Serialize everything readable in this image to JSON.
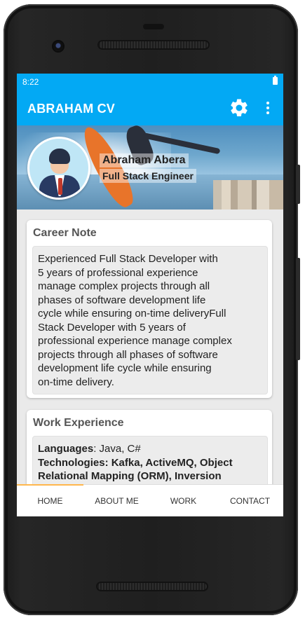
{
  "status_bar": {
    "time": "8:22"
  },
  "app_bar": {
    "title": "ABRAHAM CV",
    "settings_icon": "gear-icon",
    "menu_icon": "more-vert-icon"
  },
  "profile": {
    "name": "Abraham Abera",
    "role": "Full Stack Engineer"
  },
  "career_note": {
    "title": "Career Note",
    "lines": [
      "Experienced Full Stack Developer with",
      "5 years of professional experience",
      "manage complex projects through all",
      "phases of software development life",
      "cycle while ensuring on-time deliveryFull",
      "Stack Developer with 5 years of",
      "professional experience manage complex",
      "projects through all phases of software",
      "development life cycle while ensuring",
      "on-time delivery."
    ]
  },
  "work_experience": {
    "title": "Work Experience",
    "languages_label": "Languages",
    "languages_value": ": Java, C#",
    "technologies_lines": [
      "Technologies: Kafka, ActiveMQ, Object",
      "Relational Mapping (ORM), Inversion"
    ]
  },
  "bottom_nav": {
    "items": [
      "HOME",
      "ABOUT ME",
      "WORK",
      "CONTACT"
    ],
    "active_index": 0
  },
  "colors": {
    "primary": "#03a9f4",
    "accent": "#ffb74d"
  }
}
